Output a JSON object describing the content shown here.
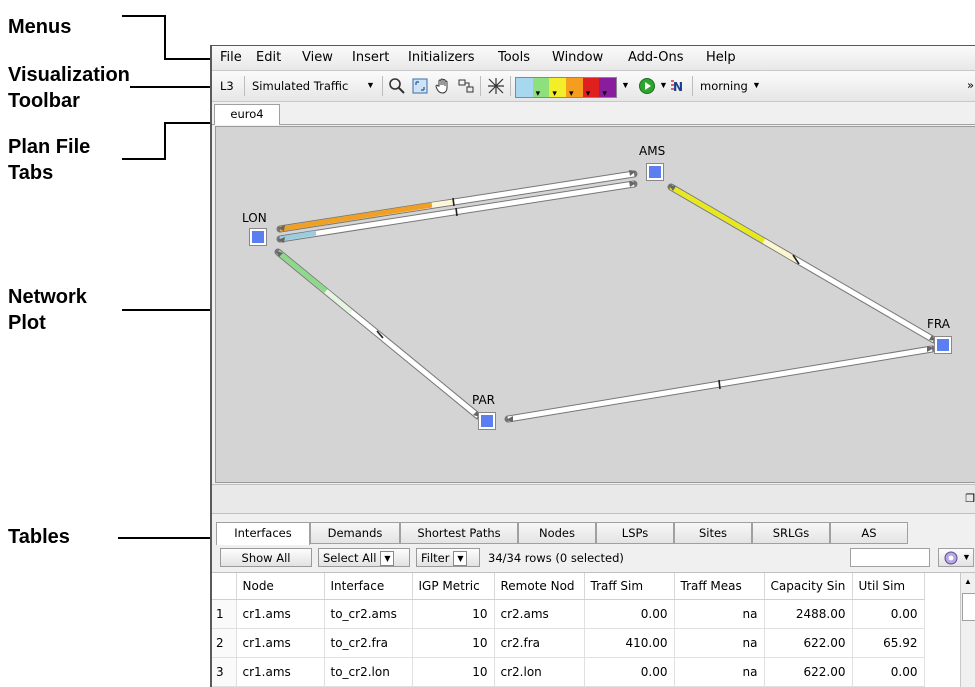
{
  "callouts": {
    "menus": "Menus",
    "visualization_toolbar": [
      "Visualization",
      "Toolbar"
    ],
    "plan_file_tabs": [
      "Plan File",
      "Tabs"
    ],
    "network_plot": [
      "Network",
      "Plot"
    ],
    "tables": "Tables"
  },
  "menubar": [
    "File",
    "Edit",
    "View",
    "Insert",
    "Initializers",
    "Tools",
    "Window",
    "Add-Ons",
    "Help"
  ],
  "toolbar": {
    "layer": "L3",
    "traffic_mode": "Simulated Traffic",
    "plot_icons": [
      "zoom-icon",
      "fit-view-icon",
      "hand-pan-icon",
      "layout-icon",
      "grid-icon"
    ],
    "color_legend": [
      "#a8d8f0",
      "#8ee07c",
      "#f2ef2a",
      "#f59d1f",
      "#e01f1f",
      "#8a1c9e"
    ],
    "run_icon": "play-icon",
    "simulation_icon": "n-failure-icon",
    "traffic_level": "morning",
    "overflow": "»"
  },
  "plan_tabs": [
    "euro4"
  ],
  "network": {
    "nodes": {
      "lon": "LON",
      "ams": "AMS",
      "fra": "FRA",
      "par": "PAR"
    },
    "node_color": "#5b7ff0",
    "link_colors": {
      "lon_ams_upper": "#f0a024",
      "lon_ams_lower": "#9bcde0",
      "ams_fra": "#e8e81e",
      "lon_par": "#8ed88a"
    }
  },
  "table_tabs": [
    "Interfaces",
    "Demands",
    "Shortest Paths",
    "Nodes",
    "LSPs",
    "Sites",
    "SRLGs",
    "AS"
  ],
  "table_toolbar": {
    "show_all": "Show All",
    "select_all": "Select All",
    "filter": "Filter",
    "row_count": "34/34 rows (0 selected)"
  },
  "interfaces_table": {
    "columns": [
      "",
      "Node",
      "Interface",
      "IGP Metric",
      "Remote Nod",
      "Traff Sim",
      "Traff Meas",
      "Capacity Sin",
      "Util Sim"
    ],
    "rows": [
      [
        "1",
        "cr1.ams",
        "to_cr2.ams",
        "10",
        "cr2.ams",
        "0.00",
        "na",
        "2488.00",
        "0.00"
      ],
      [
        "2",
        "cr1.ams",
        "to_cr2.fra",
        "10",
        "cr2.fra",
        "410.00",
        "na",
        "622.00",
        "65.92"
      ],
      [
        "3",
        "cr1.ams",
        "to_cr2.lon",
        "10",
        "cr2.lon",
        "0.00",
        "na",
        "622.00",
        "0.00"
      ]
    ]
  }
}
